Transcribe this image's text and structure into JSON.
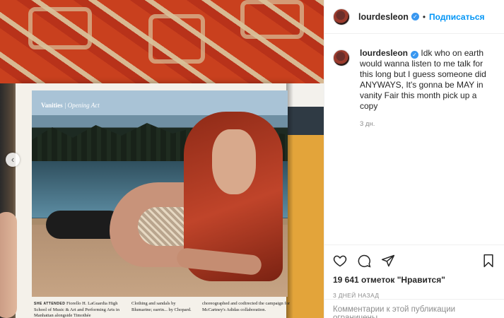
{
  "post": {
    "username": "lourdesleon",
    "follow_label": "Подписаться",
    "separator": "•",
    "caption": "Idk who on earth would wanna listen to me talk for this long but I guess someone did ANYWAYS, It's gonna be MAY in vanity Fair this month pick up a copy",
    "time_ago": "3 дн.",
    "likes": "19 641 отметок \"Нравится\"",
    "posted": "3 ДНЕЙ НАЗАД",
    "comments_disabled": "Комментарии к этой публикации ограничены.",
    "verified_icon": "✓",
    "carousel_prev_icon": "‹"
  },
  "magazine": {
    "section": "Vanities",
    "subsection": "Opening Act",
    "caption_col1_lead": "SHE ATTENDED",
    "caption_col1": "Fiorello H. LaGuardia High School of Music & Art and Performing Arts in Manhattan alongside Timothée",
    "caption_col2_lead": "Clothing and sandals by",
    "caption_col2": "Blumarine; earrin... by Chopard.",
    "caption_col3": "choreographed and codirected the campaign for McCartney's Adidas collaboration."
  },
  "colors": {
    "accent": "#0095f6",
    "verified": "#3897f0",
    "muted": "#8e8e8e",
    "text": "#262626"
  }
}
